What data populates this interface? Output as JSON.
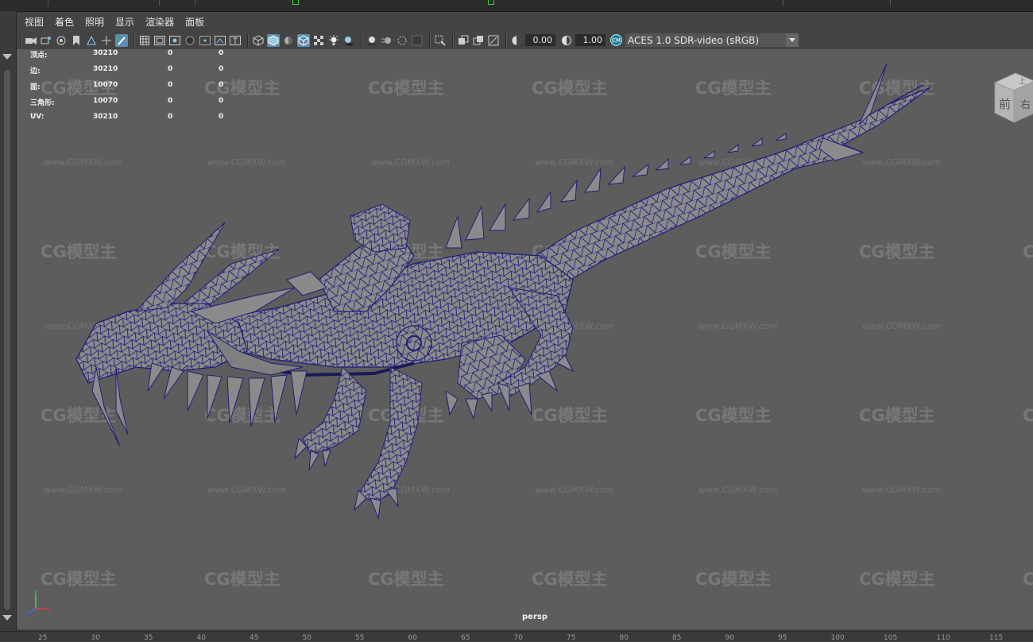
{
  "menu": {
    "items": [
      "视图",
      "着色",
      "照明",
      "显示",
      "渲染器",
      "面板"
    ]
  },
  "toolbar": {
    "field_a": "0.00",
    "field_b": "1.00",
    "colorspace_badge": "CM",
    "colorspace": "ACES 1.0 SDR-video (sRGB)"
  },
  "hud": {
    "rows": [
      {
        "label": "顶点:",
        "v1": "30210",
        "v2": "0",
        "v3": "0"
      },
      {
        "label": "边:",
        "v1": "30210",
        "v2": "0",
        "v3": "0"
      },
      {
        "label": "面:",
        "v1": "10070",
        "v2": "0",
        "v3": "0"
      },
      {
        "label": "三角形:",
        "v1": "10070",
        "v2": "0",
        "v3": "0"
      },
      {
        "label": "UV:",
        "v1": "30210",
        "v2": "0",
        "v3": "0"
      }
    ]
  },
  "viewcube": {
    "face_front": "前",
    "face_right": "右",
    "face_top": "上"
  },
  "camera": {
    "name": "persp"
  },
  "watermark": {
    "logo": "CG模型主",
    "url": "www.CGMXW.com"
  },
  "ruler": {
    "ticks": [
      "25",
      "30",
      "35",
      "40",
      "45",
      "50",
      "55",
      "60",
      "65",
      "70",
      "75",
      "80",
      "85",
      "90",
      "95",
      "100",
      "105",
      "110",
      "115"
    ]
  },
  "icons": {
    "toolbar": [
      "camera-icon",
      "camera-attr-icon",
      "bookmark-icon",
      "image-plane-icon",
      "grid-icon",
      "film-gate-icon",
      "resolution-gate-icon",
      "gate-mask-icon",
      "field-chart-icon",
      "safe-action-icon",
      "safe-title-icon",
      "wireframe-icon",
      "smooth-shade-icon",
      "default-material-icon",
      "xray-icon",
      "light-icon",
      "shadow-icon",
      "ao-icon",
      "motion-blur-icon",
      "isolate-icon",
      "exposure-icon",
      "gamma-icon"
    ]
  },
  "colors": {
    "viewport_bg": "#5d5d5d",
    "wire": "#1e1e7a",
    "mesh_fill": "#8a8a8a",
    "ui_bg": "#444444",
    "active_blue": "#5b8fb0"
  }
}
